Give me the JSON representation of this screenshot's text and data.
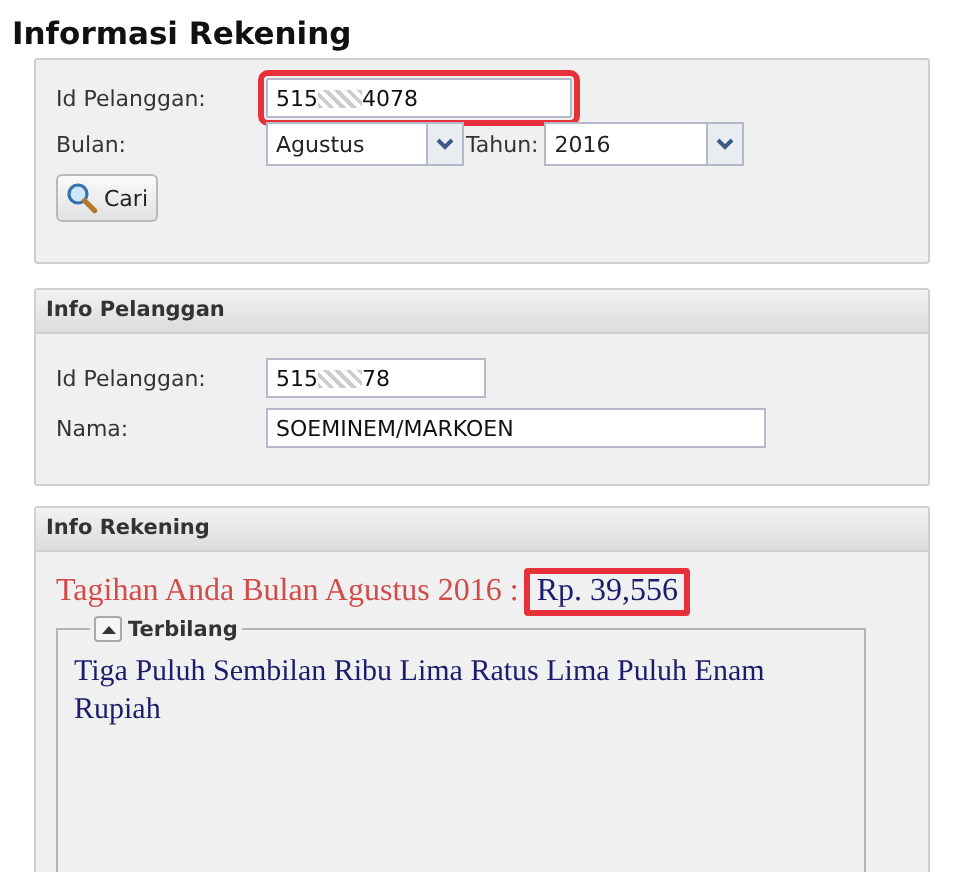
{
  "title": "Informasi Rekening",
  "search_form": {
    "id_label": "Id Pelanggan:",
    "id_value": {
      "prefix": "515",
      "suffix": "4078",
      "highlighted": true
    },
    "month_label": "Bulan:",
    "month_value": "Agustus",
    "year_label": "Tahun:",
    "year_value": "2016",
    "search_button": "Cari"
  },
  "customer_panel": {
    "header": "Info Pelanggan",
    "id_label": "Id Pelanggan:",
    "id_value": {
      "prefix": "515",
      "suffix": "78"
    },
    "name_label": "Nama:",
    "name_value": "SOEMINEM/MARKOEN"
  },
  "account_panel": {
    "header": "Info Rekening",
    "bill_text": "Tagihan Anda Bulan Agustus 2016 :",
    "amount": "Rp. 39,556",
    "amount_highlighted": true,
    "fieldset": {
      "legend": "Terbilang",
      "expanded": true,
      "text": "Tiga Puluh Sembilan Ribu Lima Ratus Lima Puluh Enam Rupiah"
    }
  }
}
